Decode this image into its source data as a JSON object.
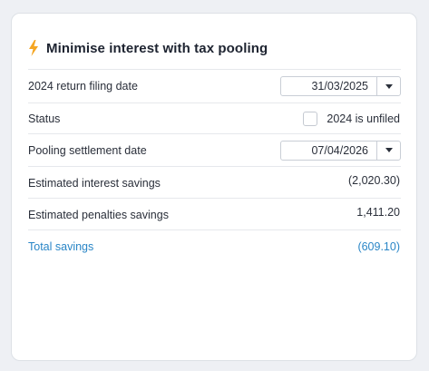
{
  "card": {
    "title": "Minimise interest with tax pooling",
    "icon": "lightning-bolt-icon",
    "accent_color": "#f5a623"
  },
  "rows": {
    "filing_date": {
      "label": "2024 return filing date",
      "value": "31/03/2025"
    },
    "status": {
      "label": "Status",
      "checkbox_label": "2024 is unfiled",
      "checked": false
    },
    "settlement_date": {
      "label": "Pooling settlement date",
      "value": "07/04/2026"
    },
    "interest_savings": {
      "label": "Estimated interest savings",
      "value": "(2,020.30)"
    },
    "penalties_savings": {
      "label": "Estimated penalties savings",
      "value": "1,411.20"
    },
    "total_savings": {
      "label": "Total savings",
      "value": "(609.10)",
      "color": "#2a86c7"
    }
  }
}
